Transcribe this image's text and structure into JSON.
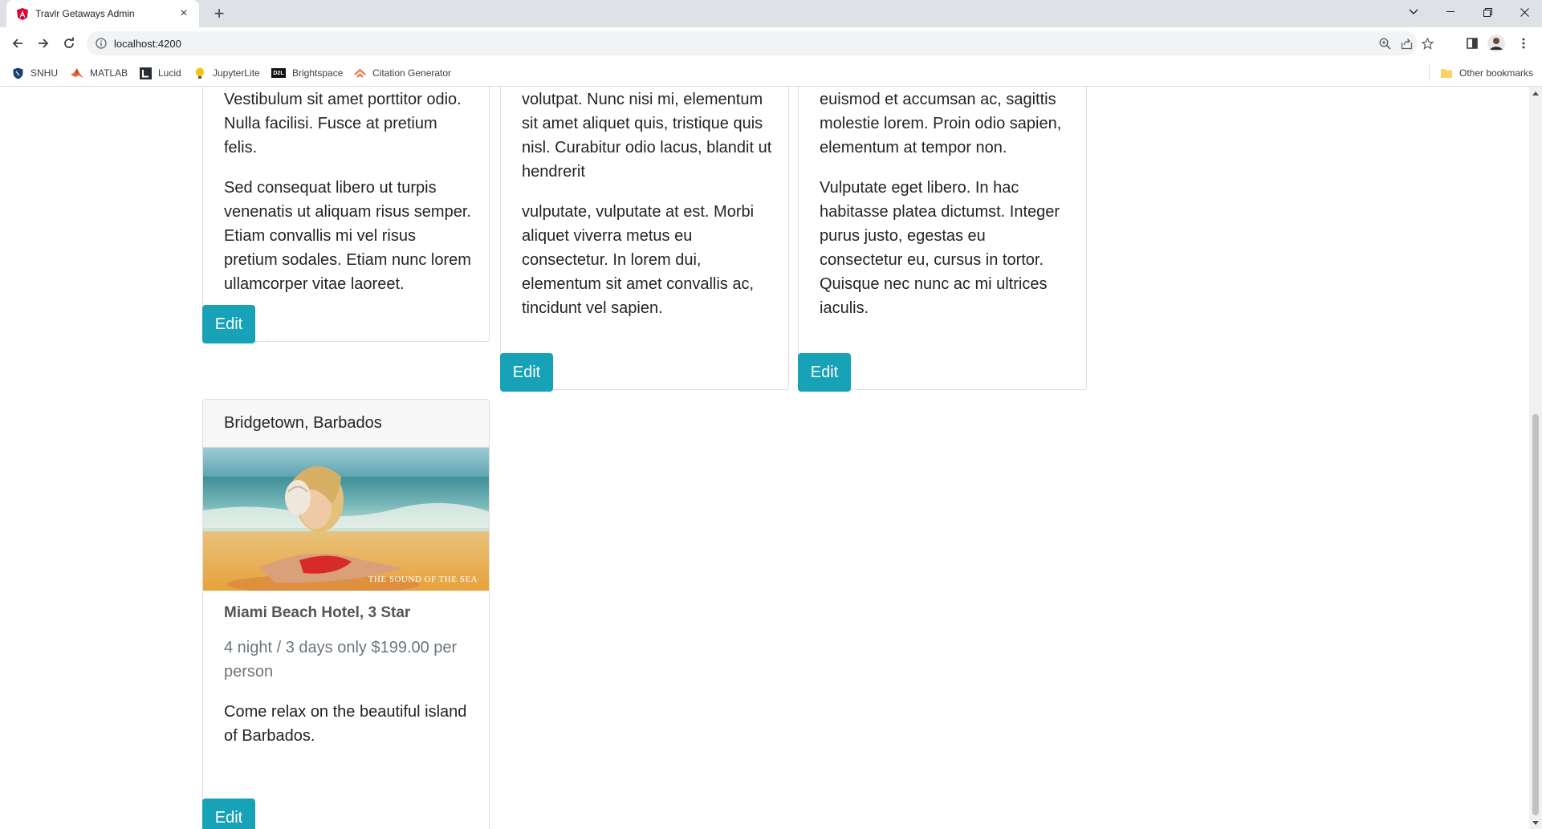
{
  "browser": {
    "tab_title": "Travlr Getaways Admin",
    "url": "localhost:4200",
    "bookmarks": [
      {
        "label": "SNHU",
        "icon": "shield-icon"
      },
      {
        "label": "MATLAB",
        "icon": "matlab-icon"
      },
      {
        "label": "Lucid",
        "icon": "lucid-icon"
      },
      {
        "label": "JupyterLite",
        "icon": "jupyter-icon"
      },
      {
        "label": "Brightspace",
        "icon": "d2l-icon"
      },
      {
        "label": "Citation Generator",
        "icon": "citation-icon"
      }
    ],
    "other_bookmarks": "Other bookmarks"
  },
  "cards": [
    {
      "paragraphs": [
        "Vestibulum sit amet porttitor odio. Nulla facilisi. Fusce at pretium felis.",
        "Sed consequat libero ut turpis venenatis ut aliquam risus semper. Etiam convallis mi vel risus pretium sodales. Etiam nunc lorem ullamcorper vitae laoreet."
      ],
      "edit_label": "Edit"
    },
    {
      "paragraphs": [
        "volutpat. Nunc nisi mi, elementum sit amet aliquet quis, tristique quis nisl. Curabitur odio lacus, blandit ut hendrerit",
        "vulputate, vulputate at est. Morbi aliquet viverra metus eu consectetur. In lorem dui, elementum sit amet convallis ac, tincidunt vel sapien."
      ],
      "edit_label": "Edit"
    },
    {
      "paragraphs": [
        "euismod et accumsan ac, sagittis molestie lorem. Proin odio sapien, elementum at tempor non.",
        "Vulputate eget libero. In hac habitasse platea dictumst. Integer purus justo, egestas eu consectetur eu, cursus in tortor. Quisque nec nunc ac mi ultrices iaculis."
      ],
      "edit_label": "Edit"
    },
    {
      "header": "Bridgetown, Barbados",
      "image_caption": "THE SOUND OF THE SEA",
      "title": "Miami Beach Hotel, 3 Star",
      "subtitle": "4 night / 3 days only $199.00 per person",
      "description": "Come relax on the beautiful island of Barbados.",
      "edit_label": "Edit"
    }
  ],
  "colors": {
    "edit_button": "#17a2b8",
    "tabbar": "#dee1e6"
  }
}
